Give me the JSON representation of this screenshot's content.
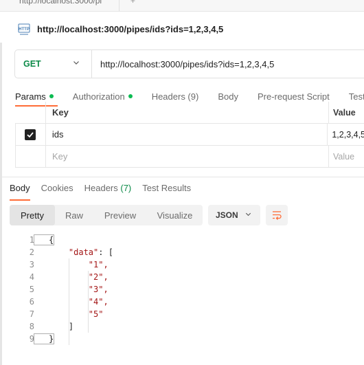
{
  "top_tab": {
    "title": "http://localhost:3000/pi"
  },
  "request": {
    "title": "http://localhost:3000/pipes/ids?ids=1,2,3,4,5",
    "method": "GET",
    "url": "http://localhost:3000/pipes/ids?ids=1,2,3,4,5"
  },
  "request_tabs": {
    "params": "Params",
    "authorization": "Authorization",
    "headers": "Headers (9)",
    "body": "Body",
    "prerequest": "Pre-request Script",
    "tests": "Tests"
  },
  "params_table": {
    "key_header": "Key",
    "value_header": "Value",
    "rows": [
      {
        "key": "ids",
        "value": "1,2,3,4,5",
        "checked": true
      }
    ],
    "placeholder_key": "Key",
    "placeholder_value": "Value"
  },
  "response_tabs": {
    "body": "Body",
    "cookies": "Cookies",
    "headers_label": "Headers",
    "headers_count": "(7)",
    "test_results": "Test Results"
  },
  "view_modes": {
    "pretty": "Pretty",
    "raw": "Raw",
    "preview": "Preview",
    "visualize": "Visualize"
  },
  "format": "JSON",
  "code": {
    "line_numbers": [
      "1",
      "2",
      "3",
      "4",
      "5",
      "6",
      "7",
      "8",
      "9"
    ],
    "lines": [
      "{",
      "    \"data\": [",
      "        \"1\",",
      "        \"2\",",
      "        \"3\",",
      "        \"4\",",
      "        \"5\"",
      "    ]",
      "}"
    ]
  },
  "colors": {
    "accent": "#ff6c37",
    "get_method": "#0b8a47",
    "status_dot": "#0cbb52",
    "string": "#a31515"
  },
  "icons": [
    "http-icon",
    "chevron-down-icon",
    "check-icon",
    "wrap-lines-icon"
  ]
}
